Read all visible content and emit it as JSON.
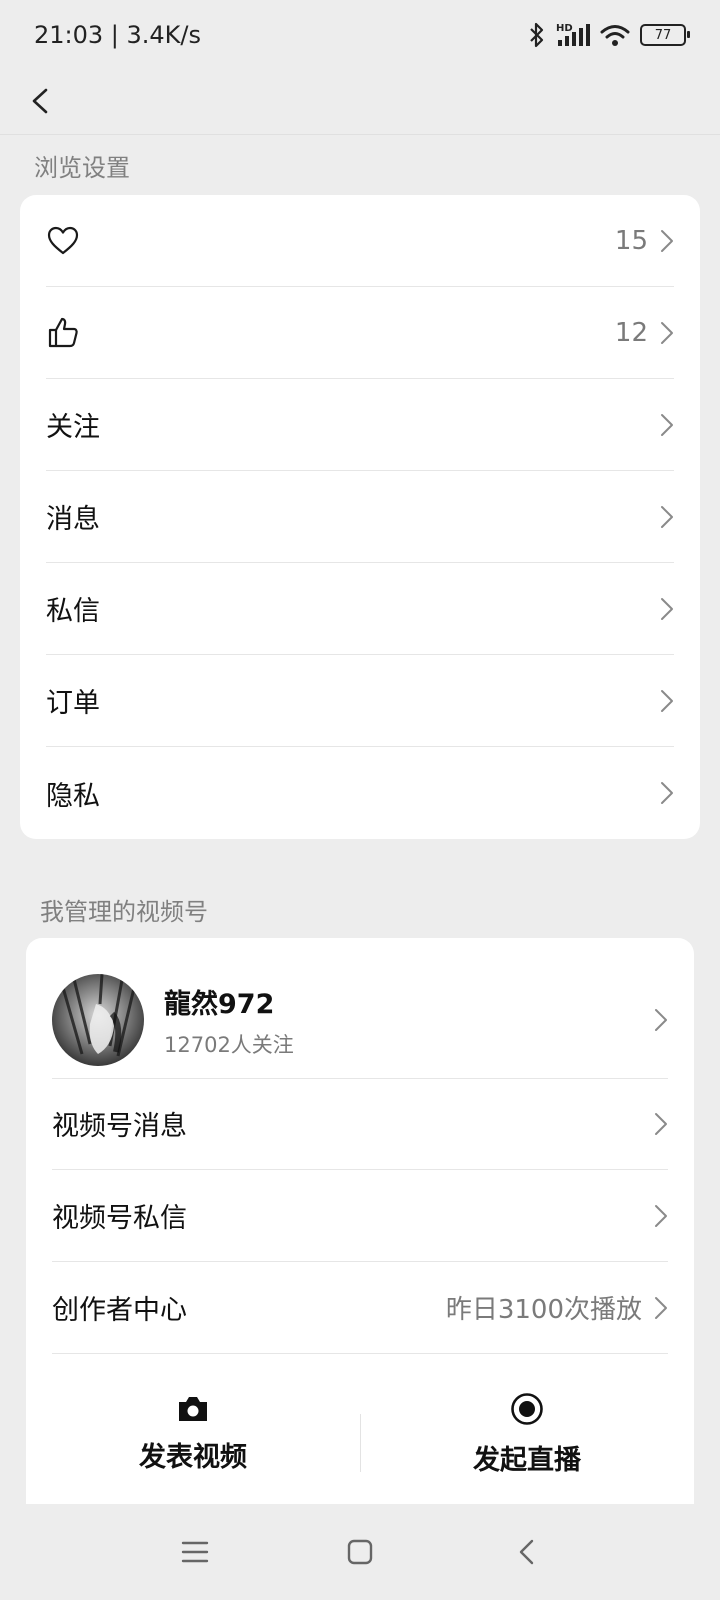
{
  "status_bar": {
    "time_speed": "21:03 | 3.4K/s",
    "network_badge": "HD",
    "battery": "77"
  },
  "browse_section": {
    "title": "浏览设置",
    "items": [
      {
        "icon": "heart-icon",
        "value": "15"
      },
      {
        "icon": "thumbs-up-icon",
        "value": "12"
      },
      {
        "label": "关注"
      },
      {
        "label": "消息"
      },
      {
        "label": "私信"
      },
      {
        "label": "订单"
      },
      {
        "label": "隐私"
      }
    ]
  },
  "channels_section": {
    "title": "我管理的视频号",
    "profile": {
      "name": "龍然972",
      "followers": "12702人关注"
    },
    "items": [
      {
        "label": "视频号消息"
      },
      {
        "label": "视频号私信"
      },
      {
        "label": "创作者中心",
        "value": "昨日3100次播放"
      }
    ],
    "actions": [
      {
        "icon": "camera-icon",
        "label": "发表视频"
      },
      {
        "icon": "live-record-icon",
        "label": "发起直播"
      }
    ]
  },
  "colors": {
    "background": "#ededed",
    "card": "#ffffff",
    "text": "#111111",
    "muted": "#7a7a7a",
    "divider": "#e6e6e6"
  }
}
